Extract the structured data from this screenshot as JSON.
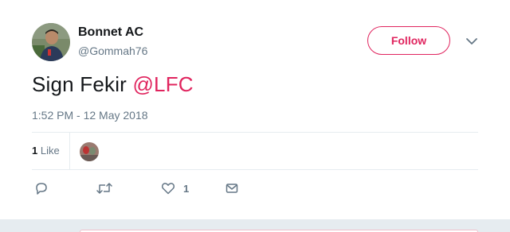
{
  "author": {
    "display_name": "Bonnet AC",
    "handle": "@Gommah76",
    "avatar_icon": "profile-photo"
  },
  "follow_button": {
    "label": "Follow"
  },
  "menu": {
    "icon": "chevron-down-icon"
  },
  "tweet": {
    "text": "Sign Fekir ",
    "mention": "@LFC",
    "timestamp": "1:52 PM - 12 May 2018"
  },
  "stats": {
    "like_count": "1",
    "like_label": "Like"
  },
  "actions": {
    "reply_icon": "reply-icon",
    "retweet_icon": "retweet-icon",
    "like_icon": "heart-icon",
    "like_count": "1",
    "message_icon": "envelope-icon"
  },
  "colors": {
    "accent": "#e0245e",
    "secondary_text": "#657786",
    "divider": "#e6ecf0"
  }
}
